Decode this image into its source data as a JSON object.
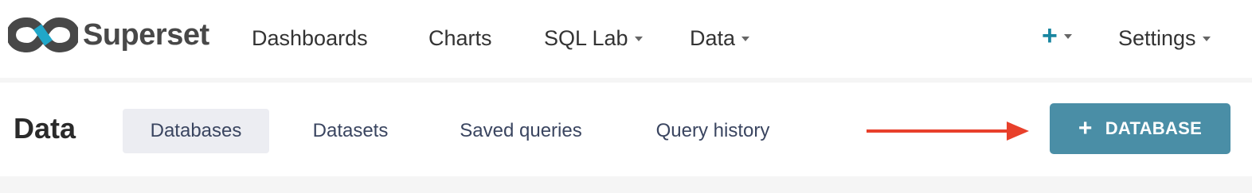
{
  "app": {
    "name": "Superset"
  },
  "nav": {
    "dashboards": "Dashboards",
    "charts": "Charts",
    "sql_lab": "SQL Lab",
    "data": "Data",
    "plus": "+",
    "settings": "Settings"
  },
  "page": {
    "title": "Data",
    "tabs": [
      {
        "label": "Databases",
        "active": true
      },
      {
        "label": "Datasets",
        "active": false
      },
      {
        "label": "Saved queries",
        "active": false
      },
      {
        "label": "Query history",
        "active": false
      }
    ],
    "add_button": {
      "plus": "+",
      "label": "DATABASE"
    }
  },
  "colors": {
    "brand_dark": "#484848",
    "brand_blue": "#20a7c9",
    "button": "#4a8ea6",
    "arrow": "#e8402b",
    "active_tab_bg": "#ecedf2"
  }
}
